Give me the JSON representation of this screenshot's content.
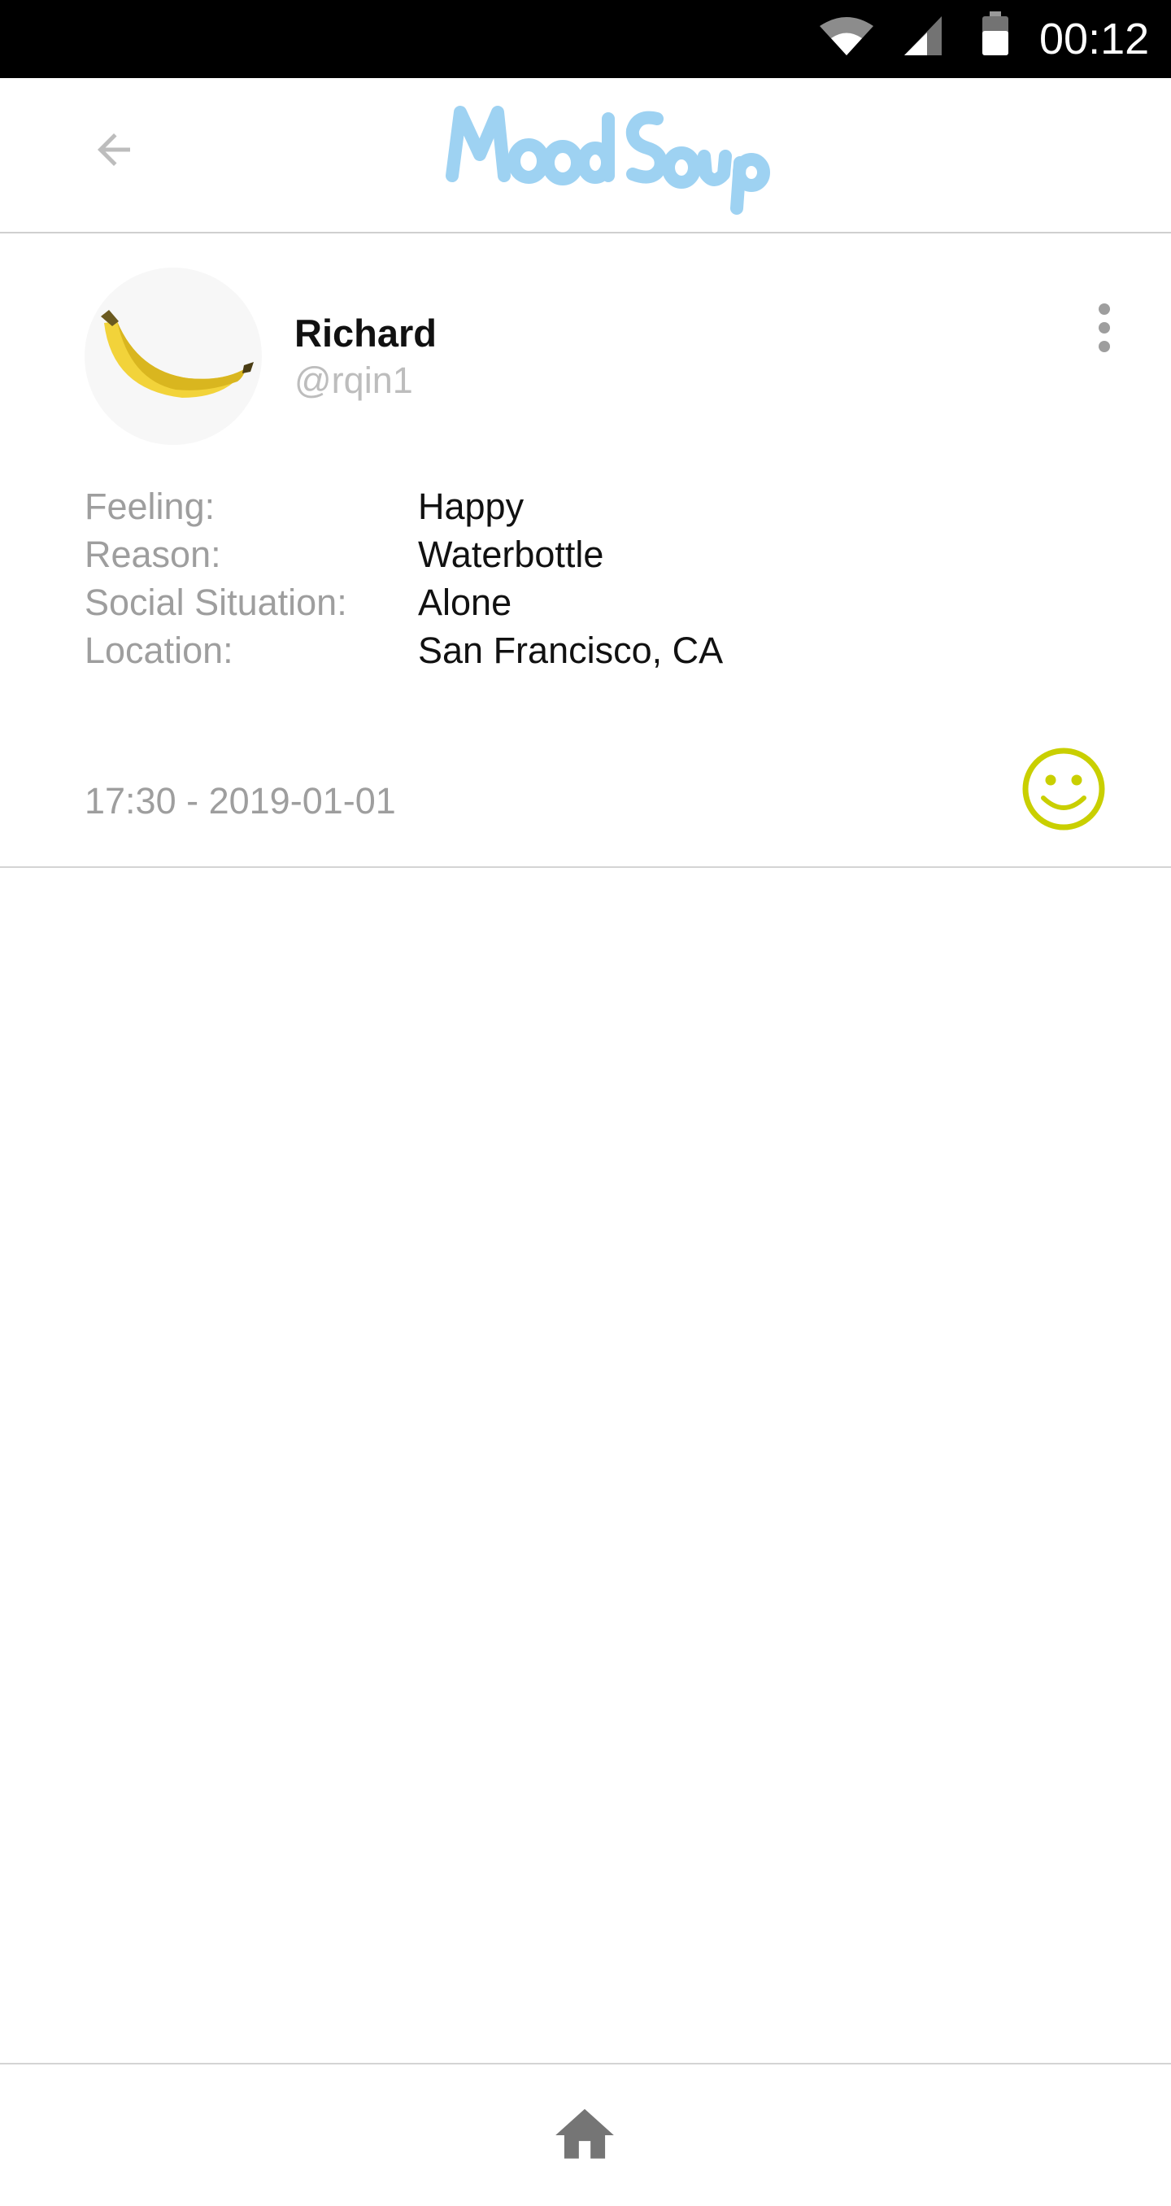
{
  "status_bar": {
    "time": "00:12",
    "icons": [
      "wifi-icon",
      "cell-signal-icon",
      "battery-icon"
    ]
  },
  "app_bar": {
    "logo_text": "MoodSoup",
    "back_icon": "arrow-left-icon",
    "logo_color": "#9ed2f2"
  },
  "post": {
    "user": {
      "name": "Richard",
      "handle": "@rqin1",
      "avatar": "banana-image"
    },
    "details": [
      {
        "label": "Feeling:",
        "value": "Happy"
      },
      {
        "label": "Reason:",
        "value": "Waterbottle"
      },
      {
        "label": "Social Situation:",
        "value": "Alone"
      },
      {
        "label": "Location:",
        "value": "San Francisco, CA"
      }
    ],
    "timestamp": "17:30 - 2019-01-01",
    "mood_icon": "smiley-face-icon",
    "mood_color": "#c9cf00",
    "menu_icon": "more-vertical-icon"
  },
  "bottom_nav": {
    "home_icon": "home-icon"
  },
  "colors": {
    "status_bar": "#000000",
    "divider": "#d4d4d4",
    "muted_text": "#9e9e9e",
    "icon_gray": "#757575"
  }
}
